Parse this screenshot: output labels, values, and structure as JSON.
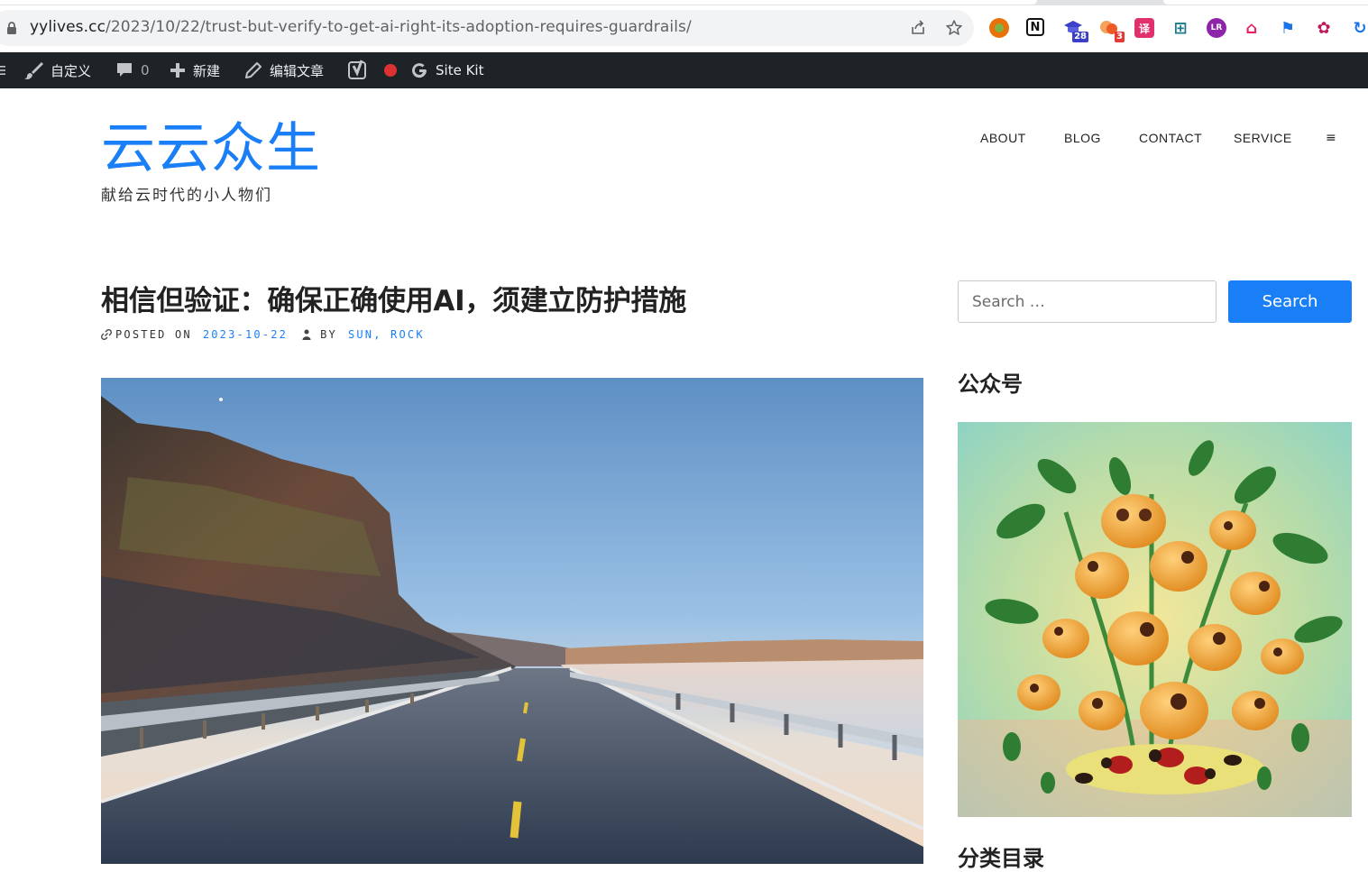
{
  "browser": {
    "url_host": "yylives.cc",
    "url_path": "/2023/10/22/trust-but-verify-to-get-ai-right-its-adoption-requires-guardrails/",
    "extensions": [
      {
        "name": "extension-circle-icon",
        "glyph": "",
        "badge": "",
        "color": "#e8710a"
      },
      {
        "name": "notion-icon",
        "glyph": "N",
        "badge": "",
        "color": "#111111"
      },
      {
        "name": "graduation-cap-icon",
        "glyph": "🎓",
        "badge": "28",
        "color": "#3b3fc9"
      },
      {
        "name": "blob-extension-icon",
        "glyph": "",
        "badge": "3",
        "color": "#f05a28"
      },
      {
        "name": "translate-icon",
        "glyph": "译",
        "badge": "",
        "color": "#e0306e"
      },
      {
        "name": "network-extension-icon",
        "glyph": "⊞",
        "badge": "",
        "color": "#1a7a8a"
      },
      {
        "name": "lr-extension-icon",
        "glyph": "LR",
        "badge": "",
        "color": "#8e24aa"
      },
      {
        "name": "hanger-icon",
        "glyph": "⌂",
        "badge": "",
        "color": "#e91e63"
      },
      {
        "name": "flag-extension-icon",
        "glyph": "⚑",
        "badge": "",
        "color": "#1a73e8"
      },
      {
        "name": "openai-icon",
        "glyph": "✿",
        "badge": "",
        "color": "#c2185b"
      },
      {
        "name": "sync-extension-icon",
        "glyph": "↻",
        "badge": "",
        "color": "#1a73e8"
      }
    ]
  },
  "admin_bar": {
    "customize": "自定义",
    "comments_count": "0",
    "new": "新建",
    "edit_post": "编辑文章",
    "site_kit": "Site Kit"
  },
  "site": {
    "title": "云云众生",
    "tagline": "献给云时代的小人物们"
  },
  "nav": {
    "about": "ABOUT",
    "blog": "BLOG",
    "contact": "CONTACT",
    "service": "SERVICE",
    "more": "≡"
  },
  "article": {
    "title": "相信但验证：确保正确使用AI，须建立防护措施",
    "posted_on_label": "POSTED ON",
    "date": "2023-10-22",
    "by_label": "BY",
    "author": "SUN, ROCK"
  },
  "sidebar": {
    "search_placeholder": "Search …",
    "search_button": "Search",
    "widget1_title": "公众号",
    "widget2_title": "分类目录"
  },
  "colors": {
    "accent": "#1a7ff7",
    "admin_bar_bg": "#1d2327"
  }
}
